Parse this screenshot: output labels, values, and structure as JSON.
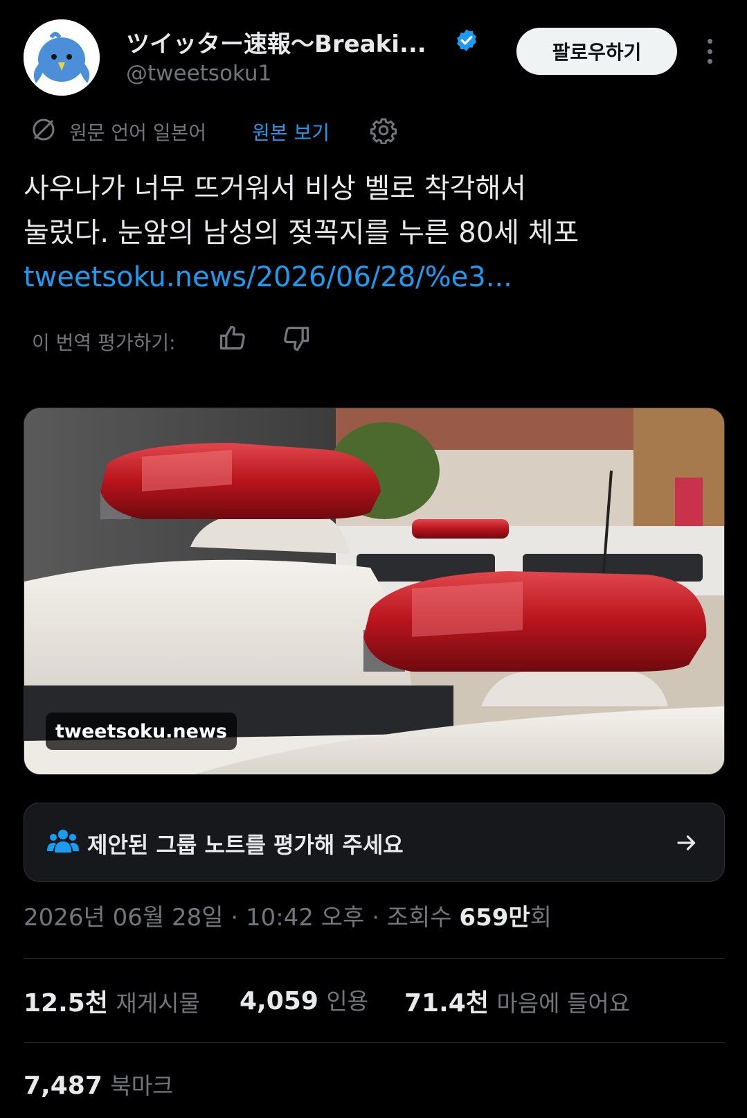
{
  "author": {
    "display_name": "ツイッター速報〜Breaki...",
    "handle": "@tweetsoku1",
    "verified": true,
    "avatar_icon": "blue-bird-avatar-icon"
  },
  "actions": {
    "follow_label": "팔로우하기",
    "more_icon": "more-vertical-icon"
  },
  "translation": {
    "source_language_label": "원문 언어 일본어",
    "show_original_label": "원본 보기",
    "rate_label": "이 번역 평가하기:"
  },
  "tweet": {
    "text_line1": "사우나가 너무 뜨거워서 비상 벨로 착각해서",
    "text_line2": "눌렀다. 눈앞의 남성의 젖꼭지를 누른 80세 체포",
    "link": "tweetsoku.news/2026/06/28/%e3..."
  },
  "media": {
    "domain_label": "tweetsoku.news",
    "description_icon": "police-car-lightbar-photo"
  },
  "community_notes": {
    "label": "제안된 그룹 노트를 평가해 주세요"
  },
  "meta": {
    "date": "2026년 06월 28일",
    "sep1": " · ",
    "time": "10:42 오후",
    "sep2": " · ",
    "views_prefix": "조회수 ",
    "views_value": "659만",
    "views_suffix": "회"
  },
  "stats": {
    "retweets_value": "12.5천",
    "retweets_label": "재게시물",
    "quotes_value": "4,059",
    "quotes_label": "인용",
    "likes_value": "71.4천",
    "likes_label": "마음에 들어요",
    "bookmarks_value": "7,487",
    "bookmarks_label": "북마크"
  },
  "colors": {
    "accent": "#1d9bf0",
    "background": "#000000",
    "muted": "#71767b"
  }
}
